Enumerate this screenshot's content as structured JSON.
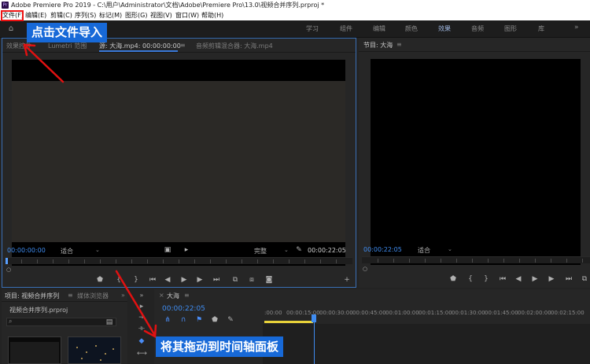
{
  "window": {
    "title": "Adobe Premiere Pro 2019 - C:\\用户\\Administrator\\文档\\Adobe\\Premiere Pro\\13.0\\视频合并序列.prproj *",
    "app_icon": "Pr"
  },
  "menu": {
    "items": [
      "文件(F)",
      "编辑(E)",
      "剪辑(C)",
      "序列(S)",
      "标记(M)",
      "图形(G)",
      "视图(V)",
      "窗口(W)",
      "帮助(H)"
    ]
  },
  "workspaces": {
    "items": [
      "学习",
      "组件",
      "编辑",
      "颜色",
      "效果",
      "音频",
      "图形",
      "库"
    ],
    "active": "效果",
    "more": "»"
  },
  "source_panel": {
    "tabs": [
      "效果控件",
      "Lumetri 范围",
      "源: 大海.mp4: 00:00:00:00",
      "≡",
      "音频剪辑混合器: 大海.mp4"
    ],
    "timecode_in": "00:00:00:00",
    "fit": "适合",
    "quality": "完整",
    "duration": "00:00:22:05"
  },
  "program_panel": {
    "title": "节目: 大海",
    "menu_icon": "≡",
    "timecode": "00:00:22:05",
    "fit": "适合"
  },
  "project_panel": {
    "tab": "项目: 视频合并序列",
    "menu_icon": "≡",
    "tab2": "媒体浏览器",
    "more": "»",
    "file": "视频合并序列.prproj"
  },
  "timeline": {
    "close": "×",
    "sequence": "大海",
    "menu_icon": "≡",
    "timecode": "00:00:22:05",
    "ruler_labels": [
      ":00:00",
      "00:00:15:00",
      "00:00:30:00",
      "00:00:45:00",
      "00:01:00:00",
      "00:01:15:00",
      "00:01:30:00",
      "00:01:45:00",
      "00:02:00:00",
      "00:02:15:00"
    ]
  },
  "annotations": {
    "step1": "点击文件导入",
    "step2": "将其拖动到时间轴面板"
  },
  "colors": {
    "accent_blue": "#3f8cf0",
    "annotation_bg": "#1769d8",
    "highlight_red": "#e11111",
    "work_area_yellow": "#e8d23a"
  }
}
